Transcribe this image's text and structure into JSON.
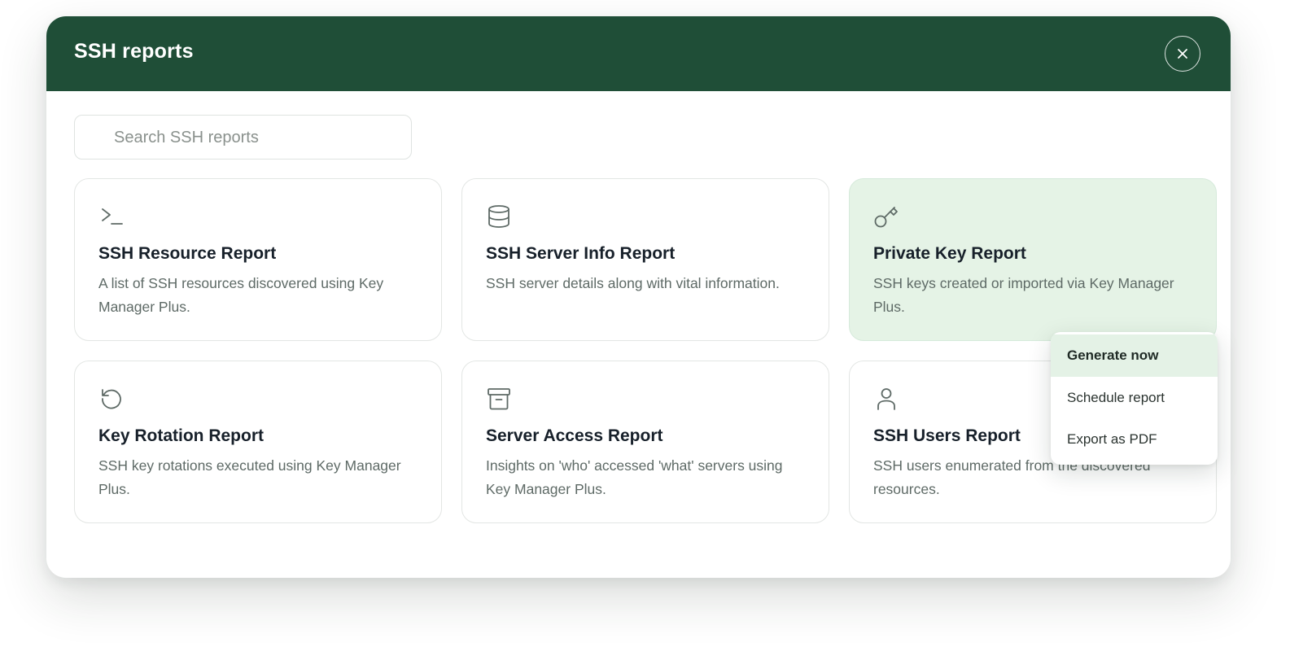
{
  "modal": {
    "title": "SSH reports"
  },
  "search": {
    "placeholder": "Search SSH reports",
    "value": ""
  },
  "cards": [
    {
      "icon": "terminal-icon",
      "title": "SSH Resource Report",
      "description": "A list of SSH resources discovered using Key Manager Plus."
    },
    {
      "icon": "database-icon",
      "title": "SSH Server Info Report",
      "description": "SSH server details along with vital information."
    },
    {
      "icon": "key-icon",
      "title": "Private Key Report",
      "description": "SSH keys created or imported via Key Manager Plus."
    },
    {
      "icon": "rotate-icon",
      "title": "Key Rotation Report",
      "description": "SSH key rotations executed using Key Manager Plus."
    },
    {
      "icon": "archive-icon",
      "title": "Server Access Report",
      "description": "Insights on 'who' accessed 'what' servers using Key Manager Plus."
    },
    {
      "icon": "user-icon",
      "title": "SSH Users Report",
      "description": "SSH users enumerated from the discovered resources."
    }
  ],
  "context_menu": {
    "items": [
      {
        "label": "Generate now"
      },
      {
        "label": "Schedule report"
      },
      {
        "label": "Export as PDF"
      }
    ]
  },
  "colors": {
    "header": "#1f4e37",
    "active_card": "#e5f3e6",
    "icon": "#5e6a66"
  }
}
